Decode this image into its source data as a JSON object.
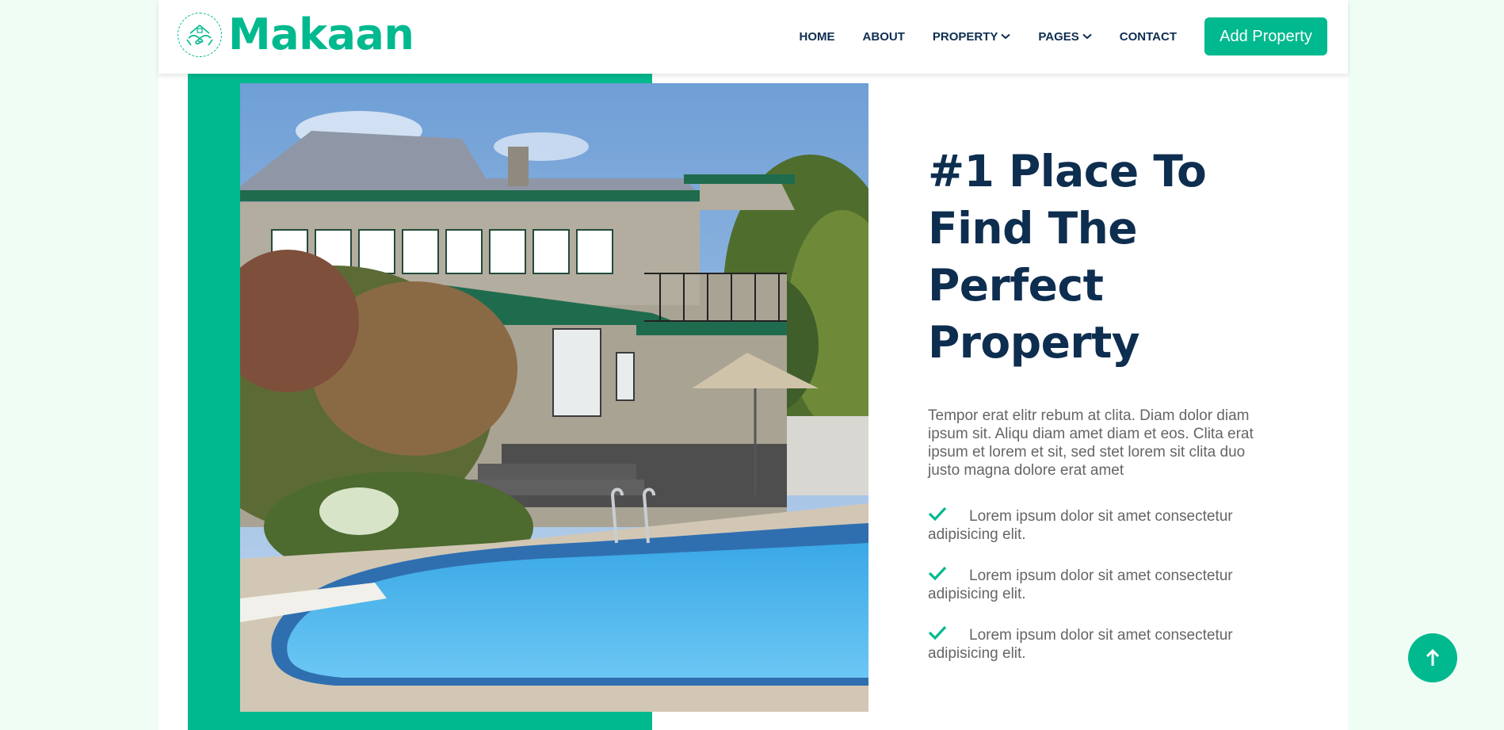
{
  "brand": {
    "name": "Makaan",
    "logo_icon": "handshake-house-icon"
  },
  "nav": {
    "items": [
      {
        "label": "HOME",
        "dropdown": false
      },
      {
        "label": "ABOUT",
        "dropdown": false
      },
      {
        "label": "PROPERTY",
        "dropdown": true
      },
      {
        "label": "PAGES",
        "dropdown": true
      },
      {
        "label": "CONTACT",
        "dropdown": false
      }
    ],
    "cta_label": "Add Property"
  },
  "hero": {
    "image_alt": "house-with-swimming-pool",
    "headline": "#1 Place To Find The Perfect Property",
    "lead": "Tempor erat elitr rebum at clita. Diam dolor diam ipsum sit. Aliqu diam amet diam et eos. Clita erat ipsum et lorem et sit, sed stet lorem sit clita duo justo magna dolore erat amet",
    "features": [
      "Lorem ipsum dolor sit amet consectetur adipisicing elit.",
      "Lorem ipsum dolor sit amet consectetur adipisicing elit.",
      "Lorem ipsum dolor sit amet consectetur adipisicing elit."
    ]
  },
  "colors": {
    "primary": "#00b98e",
    "dark": "#0e2e50",
    "text": "#666565",
    "background": "#effdf5"
  },
  "back_to_top_icon": "arrow-up-icon"
}
